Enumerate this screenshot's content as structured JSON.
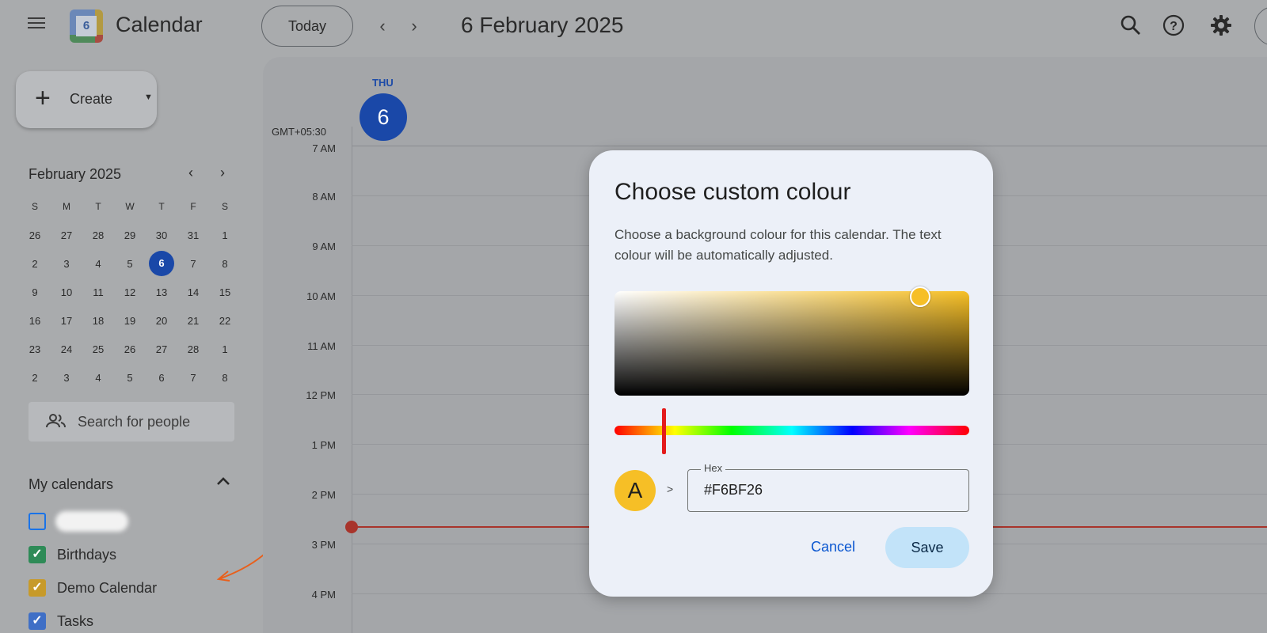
{
  "header": {
    "app_title": "Calendar",
    "logo_day": "6",
    "today_label": "Today",
    "prev_label": "‹",
    "next_label": "›",
    "date_title": "6 February 2025"
  },
  "sidebar": {
    "create_label": "Create",
    "mini_calendar": {
      "title": "February 2025",
      "weekdays": [
        "S",
        "M",
        "T",
        "W",
        "T",
        "F",
        "S"
      ],
      "weeks": [
        [
          "26",
          "27",
          "28",
          "29",
          "30",
          "31",
          "1"
        ],
        [
          "2",
          "3",
          "4",
          "5",
          "6",
          "7",
          "8"
        ],
        [
          "9",
          "10",
          "11",
          "12",
          "13",
          "14",
          "15"
        ],
        [
          "16",
          "17",
          "18",
          "19",
          "20",
          "21",
          "22"
        ],
        [
          "23",
          "24",
          "25",
          "26",
          "27",
          "28",
          "1"
        ],
        [
          "2",
          "3",
          "4",
          "5",
          "6",
          "7",
          "8"
        ]
      ],
      "selected": "6"
    },
    "search_people_placeholder": "Search for people",
    "my_calendars_title": "My calendars",
    "calendars": [
      {
        "name": "",
        "color": "#1a73e8",
        "checked": false
      },
      {
        "name": "Birthdays",
        "color": "#2e8b57",
        "checked": true
      },
      {
        "name": "Demo Calendar",
        "color": "#c79a2a",
        "checked": true
      },
      {
        "name": "Tasks",
        "color": "#3f6fc6",
        "checked": true
      }
    ]
  },
  "day_view": {
    "weekday": "THU",
    "day_number": "6",
    "timezone": "GMT+05:30",
    "hours": [
      "7 AM",
      "8 AM",
      "9 AM",
      "10 AM",
      "11 AM",
      "12 PM",
      "1 PM",
      "2 PM",
      "3 PM",
      "4 PM"
    ]
  },
  "dialog": {
    "title": "Choose custom colour",
    "description": "Choose a background colour for this calendar. The text colour will be automatically adjusted.",
    "preview_letter": "A",
    "arrow": ">",
    "hex_label": "Hex",
    "hex_value": "#F6BF26",
    "cancel_label": "Cancel",
    "save_label": "Save",
    "selected_color": "#F6BF26"
  },
  "colors": {
    "accent": "#1a48a8",
    "now_line": "#a8342b",
    "annotation_arrow": "#e8601c"
  }
}
